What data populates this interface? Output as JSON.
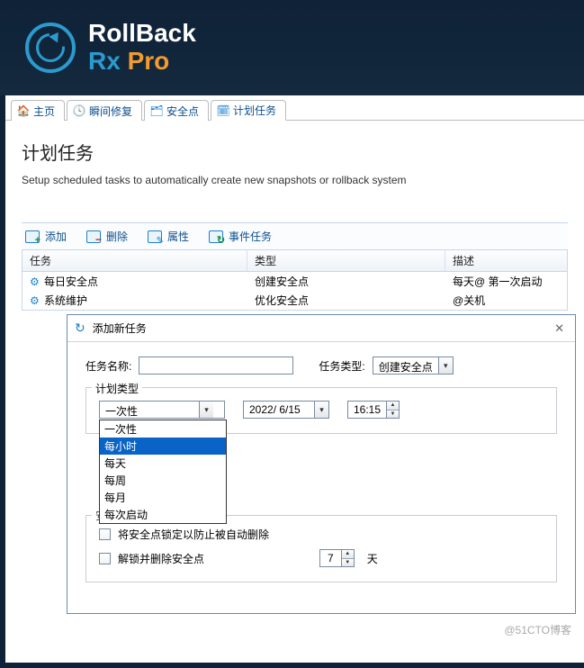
{
  "logo": {
    "line1": "RollBack",
    "rx": "Rx",
    "pro": "Pro"
  },
  "tabs": [
    {
      "label": "主页",
      "icon": "home-icon"
    },
    {
      "label": "瞬间修复",
      "icon": "restore-icon"
    },
    {
      "label": "安全点",
      "icon": "snapshot-icon"
    },
    {
      "label": "计划任务",
      "icon": "schedule-icon",
      "active": true
    }
  ],
  "page": {
    "title": "计划任务",
    "description": "Setup scheduled tasks to automatically create new snapshots or rollback system"
  },
  "toolbar": {
    "add": "添加",
    "del": "删除",
    "props": "属性",
    "event": "事件任务"
  },
  "table": {
    "headers": {
      "task": "任务",
      "type": "类型",
      "desc": "描述"
    },
    "rows": [
      {
        "task": "每日安全点",
        "type": "创建安全点",
        "desc": "每天@ 第一次启动"
      },
      {
        "task": "系统维护",
        "type": "优化安全点",
        "desc": "@关机"
      }
    ]
  },
  "dialog": {
    "title": "添加新任务",
    "labels": {
      "task_name": "任务名称:",
      "task_type": "任务类型:",
      "schedtype_legend": "计划类型",
      "days_suffix": "天",
      "security_legend": "安全点设置",
      "lock_label": "将安全点锁定以防止被自动删除",
      "unlock_label": "解锁并删除安全点"
    },
    "values": {
      "task_name": "",
      "task_type": "创建安全点",
      "schedtype_selected": "一次性",
      "date": "2022/ 6/15",
      "time": "16:15",
      "days": "7"
    },
    "schedtype_options": [
      "一次性",
      "每小时",
      "每天",
      "每周",
      "每月",
      "每次启动"
    ],
    "schedtype_highlight_index": 1
  },
  "watermark": "@51CTO博客"
}
